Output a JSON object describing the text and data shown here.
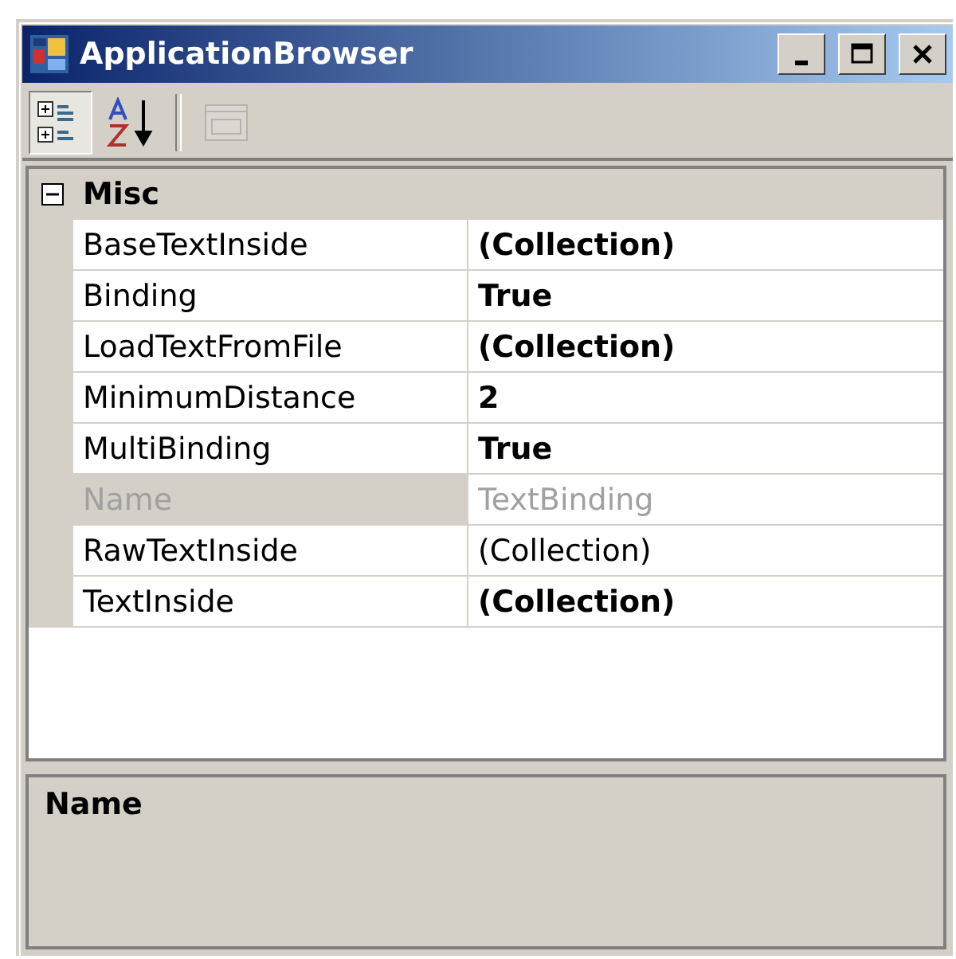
{
  "window": {
    "title": "ApplicationBrowser"
  },
  "toolbar": [
    {
      "kind": "categorized",
      "selected": true,
      "disabled": false
    },
    {
      "kind": "alphabetical",
      "selected": false,
      "disabled": false
    },
    {
      "kind": "property-pages",
      "selected": false,
      "disabled": true
    }
  ],
  "grid": {
    "category": {
      "label": "Misc",
      "expanded": true
    },
    "properties": [
      {
        "name": "BaseTextInside",
        "value": "(Collection)",
        "bold": true,
        "readonly": false
      },
      {
        "name": "Binding",
        "value": "True",
        "bold": true,
        "readonly": false
      },
      {
        "name": "LoadTextFromFile",
        "value": "(Collection)",
        "bold": true,
        "readonly": false
      },
      {
        "name": "MinimumDistance",
        "value": "2",
        "bold": true,
        "readonly": false
      },
      {
        "name": "MultiBinding",
        "value": "True",
        "bold": true,
        "readonly": false
      },
      {
        "name": "Name",
        "value": "TextBinding",
        "bold": false,
        "readonly": true
      },
      {
        "name": "RawTextInside",
        "value": "(Collection)",
        "bold": false,
        "readonly": false
      },
      {
        "name": "TextInside",
        "value": "(Collection)",
        "bold": true,
        "readonly": false
      }
    ]
  },
  "description": {
    "title": "Name"
  }
}
